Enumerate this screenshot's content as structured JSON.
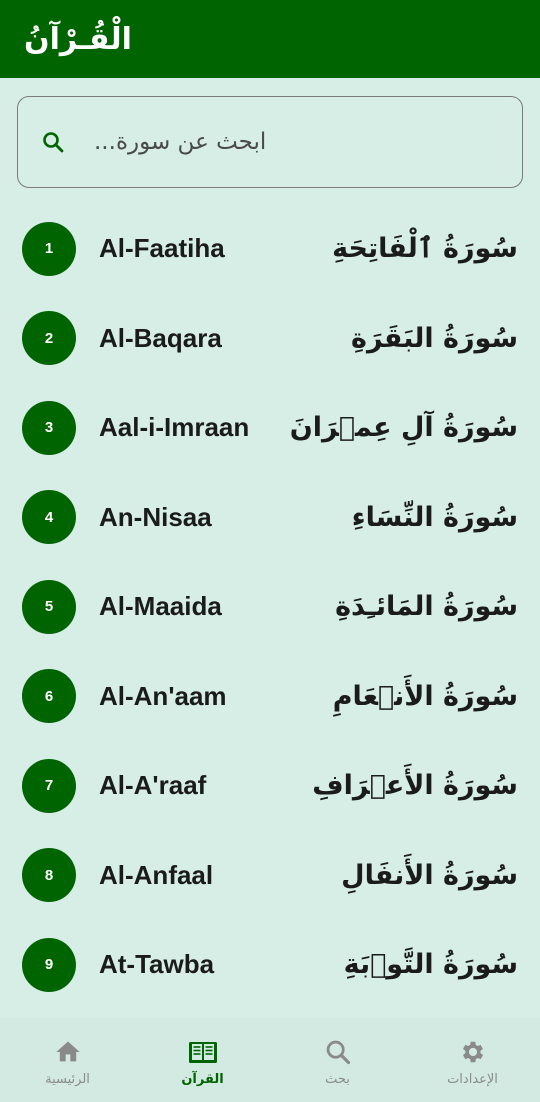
{
  "header": {
    "title": "الْقُـرْآنُ"
  },
  "search": {
    "placeholder": "...ابحث عن سورة",
    "value": "",
    "icon": "search-icon"
  },
  "surahs": [
    {
      "number": "1",
      "english": "Al-Faatiha",
      "arabic": "سُورَةُ ٱلْفَاتِحَةِ"
    },
    {
      "number": "2",
      "english": "Al-Baqara",
      "arabic": "سُورَةُ البَقَرَةِ"
    },
    {
      "number": "3",
      "english": "Aal-i-Imraan",
      "arabic": "سُورَةُ آلِ عِمۡرَانَ"
    },
    {
      "number": "4",
      "english": "An-Nisaa",
      "arabic": "سُورَةُ النِّسَاءِ"
    },
    {
      "number": "5",
      "english": "Al-Maaida",
      "arabic": "سُورَةُ المَائـِدَةِ"
    },
    {
      "number": "6",
      "english": "Al-An'aam",
      "arabic": "سُورَةُ الأَنۡعَامِ"
    },
    {
      "number": "7",
      "english": "Al-A'raaf",
      "arabic": "سُورَةُ الأَعۡرَافِ"
    },
    {
      "number": "8",
      "english": "Al-Anfaal",
      "arabic": "سُورَةُ الأَنفَالِ"
    },
    {
      "number": "9",
      "english": "At-Tawba",
      "arabic": "سُورَةُ التَّوۡبَةِ"
    }
  ],
  "nav": {
    "home": {
      "label": "الرئيسية",
      "icon": "home-icon"
    },
    "quran": {
      "label": "القرآن",
      "icon": "book-icon"
    },
    "search": {
      "label": "بحث",
      "icon": "search-icon"
    },
    "settings": {
      "label": "الإعدادات",
      "icon": "gear-icon"
    }
  },
  "colors": {
    "primary": "#006400",
    "background": "#d6eee6",
    "inactive": "#8a8a8a"
  }
}
